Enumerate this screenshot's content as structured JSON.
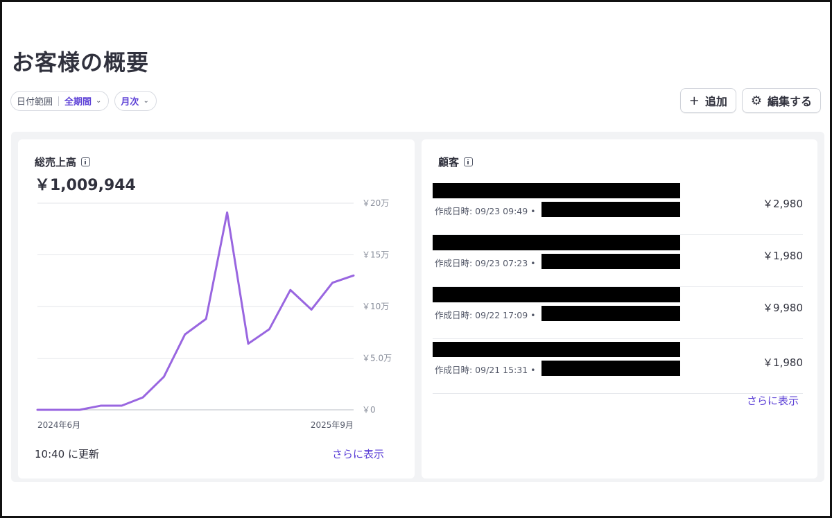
{
  "page": {
    "title": "お客様の概要"
  },
  "filters": {
    "date_range": {
      "label": "日付範囲",
      "value": "全期間"
    },
    "interval": {
      "value": "月次"
    }
  },
  "actions": {
    "add_label": "追加",
    "edit_label": "編集する"
  },
  "sales_card": {
    "title": "総売上高",
    "total": "￥1,009,944",
    "updated": "10:40 に更新",
    "more_link": "さらに表示"
  },
  "customers_card": {
    "title": "顧客",
    "more_link": "さらに表示",
    "items": [
      {
        "created": "作成日時: 09/23 09:49 •",
        "amount": "￥2,980"
      },
      {
        "created": "作成日時: 09/23 07:23 •",
        "amount": "￥1,980"
      },
      {
        "created": "作成日時: 09/22 17:09 •",
        "amount": "￥9,980"
      },
      {
        "created": "作成日時: 09/21 15:31 •",
        "amount": "￥1,980"
      }
    ]
  },
  "colors": {
    "accent": "#5b3fd6",
    "series": "#9966e0",
    "grid": "#e3e5ea",
    "axis_text": "#8a8f9c"
  },
  "chart_data": {
    "type": "line",
    "x_tick_labels": [
      "2024年6月",
      "2025年9月"
    ],
    "y_tick_labels": [
      "￥20万",
      "￥15万",
      "￥10万",
      "￥5.0万",
      "￥0"
    ],
    "y_ticks": [
      200000,
      150000,
      100000,
      50000,
      0
    ],
    "ylim": [
      0,
      200000
    ],
    "grid": true,
    "series": [
      {
        "values": [
          0,
          0,
          0,
          4000,
          4000,
          12000,
          32000,
          73000,
          88000,
          191000,
          64000,
          78000,
          116000,
          97000,
          123000,
          130000
        ]
      }
    ]
  }
}
